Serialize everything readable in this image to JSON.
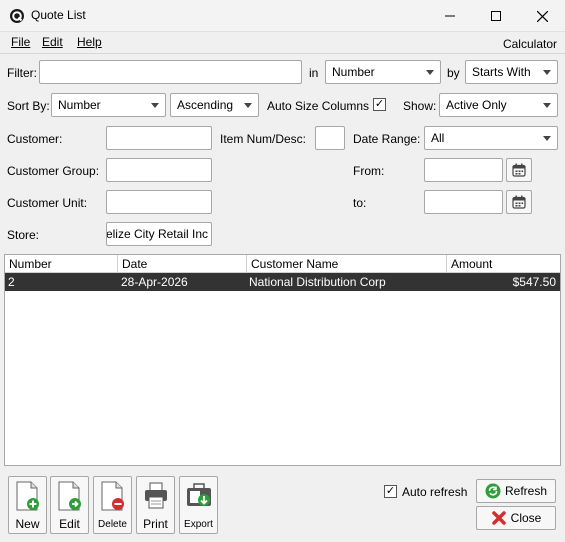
{
  "window": {
    "title": "Quote List"
  },
  "menu": {
    "file": "File",
    "edit": "Edit",
    "help": "Help",
    "calculator": "Calculator"
  },
  "filter": {
    "label": "Filter:",
    "value": "",
    "in_label": "in",
    "field": "Number",
    "by_label": "by",
    "match": "Starts With"
  },
  "sort": {
    "label": "Sort By:",
    "field": "Number",
    "order": "Ascending",
    "auto_size_label": "Auto Size Columns",
    "auto_size_checked": true,
    "show_label": "Show:",
    "show_value": "Active Only"
  },
  "customer": {
    "label": "Customer:",
    "value": ""
  },
  "item": {
    "label": "Item Num/Desc:",
    "value": ""
  },
  "date_range": {
    "label": "Date Range:",
    "value": "All",
    "from_label": "From:",
    "from_value": "",
    "to_label": "to:",
    "to_value": ""
  },
  "customer_group": {
    "label": "Customer Group:",
    "value": ""
  },
  "customer_unit": {
    "label": "Customer Unit:",
    "value": ""
  },
  "store": {
    "label": "Store:",
    "value": "Belize City Retail Inc"
  },
  "table": {
    "columns": [
      "Number",
      "Date",
      "Customer Name",
      "Amount"
    ],
    "rows": [
      {
        "number": "2",
        "date": "28-Apr-2026",
        "customer": "National Distribution Corp",
        "amount": "$547.50",
        "selected": true
      }
    ]
  },
  "toolbar": {
    "new": "New",
    "edit": "Edit",
    "delete": "Delete",
    "print": "Print",
    "export": "Export"
  },
  "actions": {
    "auto_refresh_label": "Auto refresh",
    "auto_refresh_checked": true,
    "refresh": "Refresh",
    "close": "Close"
  },
  "icons": [
    "app-logo-icon",
    "minimize-icon",
    "maximize-icon",
    "close-icon",
    "calendar-icon",
    "new-doc-icon",
    "edit-doc-icon",
    "delete-doc-icon",
    "printer-icon",
    "export-icon",
    "refresh-icon",
    "close-x-icon"
  ],
  "colors": {
    "selected_row": "#333333",
    "green": "#2e9e3a",
    "red": "#d32f2f"
  }
}
